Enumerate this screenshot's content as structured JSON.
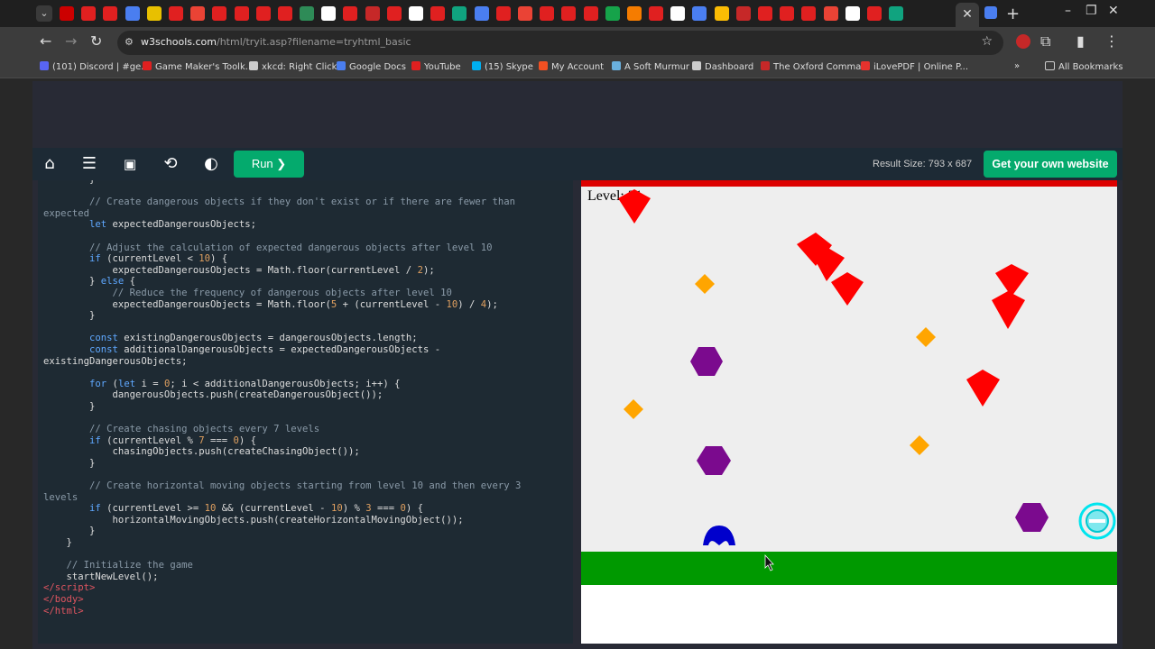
{
  "browser": {
    "url_host": "w3schools.com",
    "url_path": "/html/tryit.asp?filename=tryhtml_basic",
    "tab_icon_colors": [
      "#cc0000",
      "#e02020",
      "#e02020",
      "#4a7ef0",
      "#e8c000",
      "#e02020",
      "#ea4335",
      "#e02020",
      "#e02020",
      "#e02020",
      "#e02020",
      "#2e8b57",
      "#ffffff",
      "#e02020",
      "#c62828",
      "#e02020",
      "#ffffff",
      "#e02020",
      "#10a37f",
      "#4a7ef0",
      "#e02020",
      "#ea4335",
      "#e02020",
      "#e02020",
      "#e02020",
      "#16a34a",
      "#f57c00",
      "#e02020",
      "#ffffff",
      "#4a7ef0",
      "#fbbc04",
      "#c62828",
      "#e02020",
      "#e02020",
      "#e02020",
      "#ea4335",
      "#ffffff",
      "#e02020",
      "#10a37f"
    ],
    "bookmarks": [
      {
        "label": "(101) Discord | #ge...",
        "color": "#5865f2"
      },
      {
        "label": "Game Maker's Toolk...",
        "color": "#e02020"
      },
      {
        "label": "xkcd: Right Click",
        "color": "#cccccc"
      },
      {
        "label": "Google Docs",
        "color": "#4a7ef0"
      },
      {
        "label": "YouTube",
        "color": "#e02020"
      },
      {
        "label": "(15) Skype",
        "color": "#00aff0"
      },
      {
        "label": "My Account",
        "color": "#f25022"
      },
      {
        "label": "A Soft Murmur",
        "color": "#6ab0de"
      },
      {
        "label": "Dashboard",
        "color": "#cccccc"
      },
      {
        "label": "The Oxford Comma",
        "color": "#c62828"
      },
      {
        "label": "iLovePDF | Online P...",
        "color": "#e5322d"
      }
    ],
    "all_bookmarks": "All Bookmarks"
  },
  "editor": {
    "run_label": "Run ❯",
    "result_size": "Result Size: 793 x 687",
    "get_website": "Get your own website"
  },
  "game": {
    "level_text": "Level: 21",
    "colors": {
      "top_bar": "#dd0000",
      "danger": "#ff0000",
      "coin": "#ffa500",
      "purple": "#7b0a8e",
      "ground": "#009900",
      "player": "#0000cc",
      "power": "#00e5ee",
      "background": "#eeeeee"
    },
    "dangerous_objects": 8,
    "coins": 5,
    "purple_hexagons": 3
  }
}
